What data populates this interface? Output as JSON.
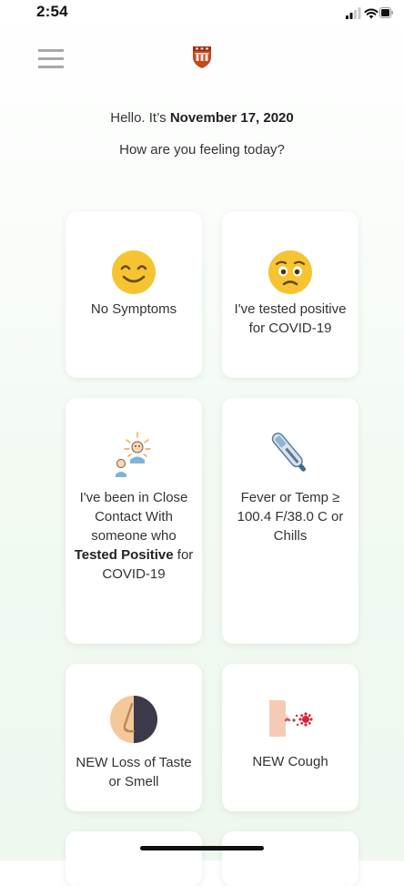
{
  "status_bar": {
    "time": "2:54",
    "icons": [
      "signal-icon",
      "wifi-icon",
      "battery-icon"
    ]
  },
  "header": {
    "menu_icon": "hamburger-menu-icon",
    "logo_icon": "university-shield-logo-icon",
    "logo_color": "#c24a1e"
  },
  "greeting": {
    "prefix": "Hello. It’s ",
    "date": "November 17, 2020",
    "question": "How are you feeling today?"
  },
  "options": [
    {
      "id": "no-symptoms",
      "icon": "smiling-face-icon",
      "label": "No Symptoms"
    },
    {
      "id": "tested-positive",
      "icon": "worried-face-icon",
      "label": "I've tested positive for COVID-19"
    },
    {
      "id": "close-contact",
      "icon": "close-contact-people-icon",
      "label_parts": {
        "line1": "I've been in Close Contact With someone who ",
        "bold": "Tested Positive",
        "line2": " for COVID-19"
      }
    },
    {
      "id": "fever",
      "icon": "thermometer-icon",
      "label": "Fever or Temp ≥ 100.4 F/38.0 C or Chills"
    },
    {
      "id": "loss-taste-smell",
      "icon": "nose-icon",
      "label": "NEW Loss of Taste or Smell"
    },
    {
      "id": "cough",
      "icon": "cough-icon",
      "label": "NEW Cough"
    }
  ],
  "colors": {
    "card_bg": "#ffffff",
    "emoji_yellow": "#f7c431",
    "background_tint": "#eef8ef"
  }
}
